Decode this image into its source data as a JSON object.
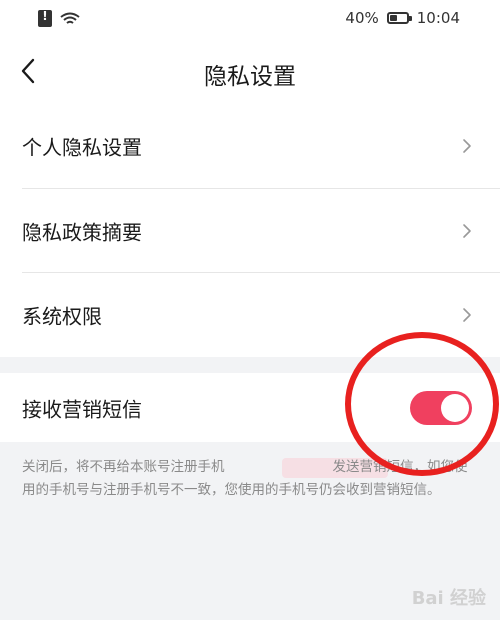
{
  "status_bar": {
    "battery_percent": "40%",
    "time": "10:04",
    "battery_level": 0.4
  },
  "header": {
    "title": "隐私设置"
  },
  "menu": {
    "items": [
      {
        "label": "个人隐私设置"
      },
      {
        "label": "隐私政策摘要"
      },
      {
        "label": "系统权限"
      }
    ]
  },
  "marketing_sms": {
    "label": "接收营销短信",
    "enabled": true,
    "description_part1": "关闭后，将不再给本账号注册手机",
    "description_part2": "发送营销短信，如您使用的手机号与注册手机号不一致，您使用的手机号仍会收到营销短信。"
  },
  "watermark": "Bai 经验",
  "colors": {
    "toggle_on": "#f0405f",
    "annotation_circle": "#e8211f",
    "section_gap": "#f2f3f5"
  }
}
